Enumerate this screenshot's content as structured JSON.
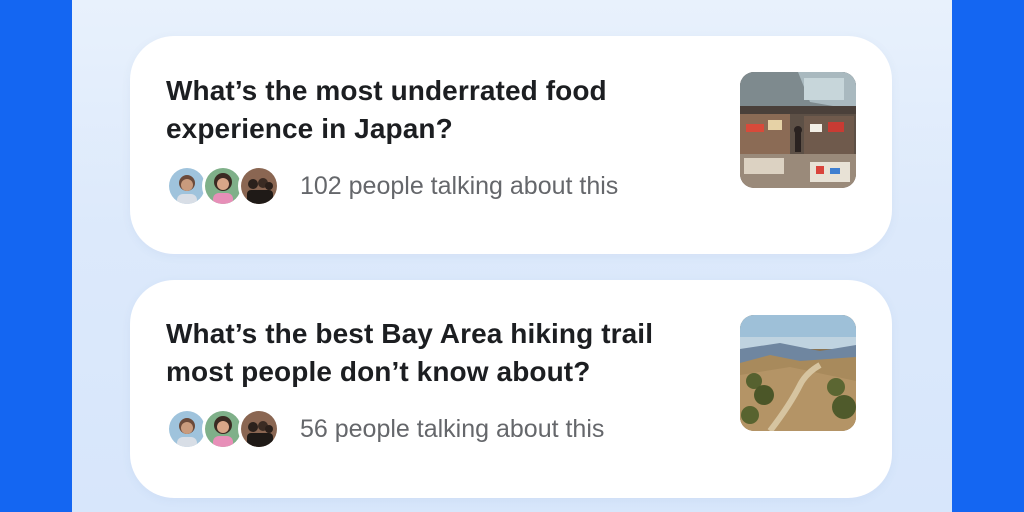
{
  "posts": [
    {
      "question": "What’s the most underrated food experience in Japan?",
      "talking": "102 people talking about this",
      "image": "japan-food-market-photo"
    },
    {
      "question": "What’s the best Bay Area hiking trail most people don’t know about?",
      "talking": "56 people talking about this",
      "image": "bay-area-hiking-trail-photo"
    }
  ],
  "colors": {
    "background": "#1466f2",
    "panel": "#e4eefc",
    "card": "#ffffff",
    "title": "#1c1e21",
    "meta": "#65676b"
  }
}
